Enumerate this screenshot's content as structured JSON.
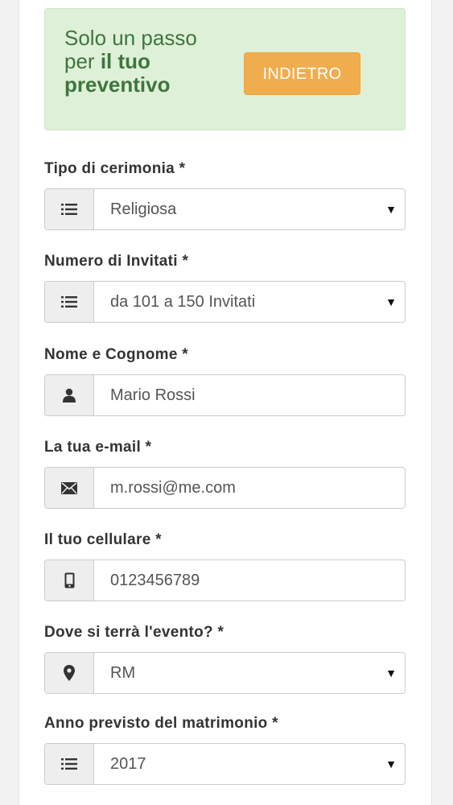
{
  "banner": {
    "line1": "Solo un passo",
    "line2_prefix": "per ",
    "line2_bold": "il tuo",
    "line3_bold": "preventivo",
    "back_button": "INDIETRO"
  },
  "form": {
    "fields": [
      {
        "label": "Tipo di cerimonia *",
        "value": "Religiosa",
        "icon": "list-icon",
        "type": "select"
      },
      {
        "label": "Numero di Invitati *",
        "value": "da 101 a 150 Invitati",
        "icon": "list-icon",
        "type": "select"
      },
      {
        "label": "Nome e Cognome *",
        "value": "Mario Rossi",
        "icon": "user-icon",
        "type": "text"
      },
      {
        "label": "La tua e-mail *",
        "value": "m.rossi@me.com",
        "icon": "envelope-icon",
        "type": "text"
      },
      {
        "label": "Il tuo cellulare *",
        "value": "0123456789",
        "icon": "phone-icon",
        "type": "text"
      },
      {
        "label": "Dove si terrà l'evento? *",
        "value": "RM",
        "icon": "map-marker-icon",
        "type": "select"
      },
      {
        "label": "Anno previsto del matrimonio *",
        "value": "2017",
        "icon": "list-icon",
        "type": "select"
      }
    ]
  },
  "colors": {
    "banner_bg": "#dff0d8",
    "banner_text": "#3c763d",
    "button_bg": "#f0ad4e",
    "addon_bg": "#eeeeee"
  }
}
